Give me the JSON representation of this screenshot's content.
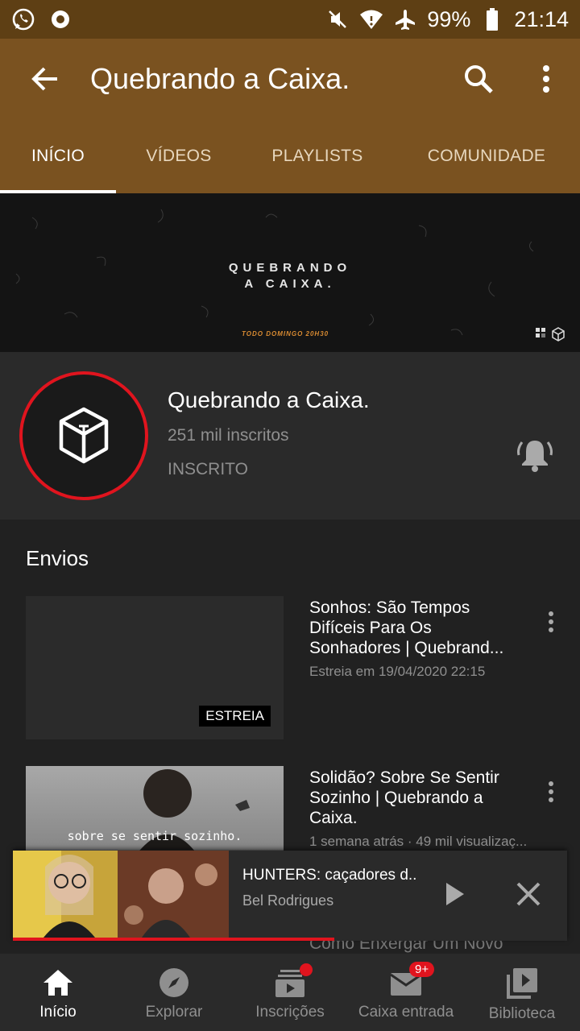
{
  "status_bar": {
    "battery": "99%",
    "time": "21:14",
    "icons_left": [
      "whatsapp-icon",
      "circle-app-icon"
    ],
    "icons_right": [
      "mute-icon",
      "wifi-icon",
      "airplane-icon",
      "battery-icon"
    ]
  },
  "app_bar": {
    "title": "Quebrando a Caixa.",
    "color": "#7a5220"
  },
  "tabs": [
    {
      "label": "INÍCIO",
      "active": true
    },
    {
      "label": "VÍDEOS",
      "active": false
    },
    {
      "label": "PLAYLISTS",
      "active": false
    },
    {
      "label": "COMUNIDADE",
      "active": false
    }
  ],
  "banner": {
    "line1": "QUEBRANDO",
    "line2": "A CAIXA.",
    "schedule": "TODO DOMINGO 20H30"
  },
  "channel": {
    "name": "Quebrando a Caixa.",
    "subscribers": "251 mil inscritos",
    "status": "INSCRITO"
  },
  "section": {
    "title": "Envios"
  },
  "videos": [
    {
      "title": "Sonhos: São Tempos Difíceis Para Os Sonhadores | Quebrand...",
      "meta": "Estreia em 19/04/2020 22:15",
      "badge": "ESTREIA"
    },
    {
      "title": "Solidão? Sobre Se Sentir Sozinho | Quebrando a Caixa.",
      "meta": "1 semana atrás · 49 mil visualizaç...",
      "thumb_caption": "sobre se sentir sozinho."
    }
  ],
  "peek_text": "Como Enxergar Um Novo",
  "mini_player": {
    "title": "HUNTERS: caçadores d..",
    "channel": "Bel Rodrigues",
    "progress": 0.58
  },
  "bottom_nav": [
    {
      "label": "Início",
      "icon": "home-icon",
      "active": true
    },
    {
      "label": "Explorar",
      "icon": "compass-icon",
      "active": false
    },
    {
      "label": "Inscrições",
      "icon": "subscriptions-icon",
      "active": false,
      "dot": true
    },
    {
      "label": "Caixa entrada",
      "icon": "inbox-icon",
      "active": false,
      "badge": "9+"
    },
    {
      "label": "Biblioteca",
      "icon": "library-icon",
      "active": false
    }
  ],
  "colors": {
    "accent": "#e0141e",
    "background": "#212121"
  }
}
